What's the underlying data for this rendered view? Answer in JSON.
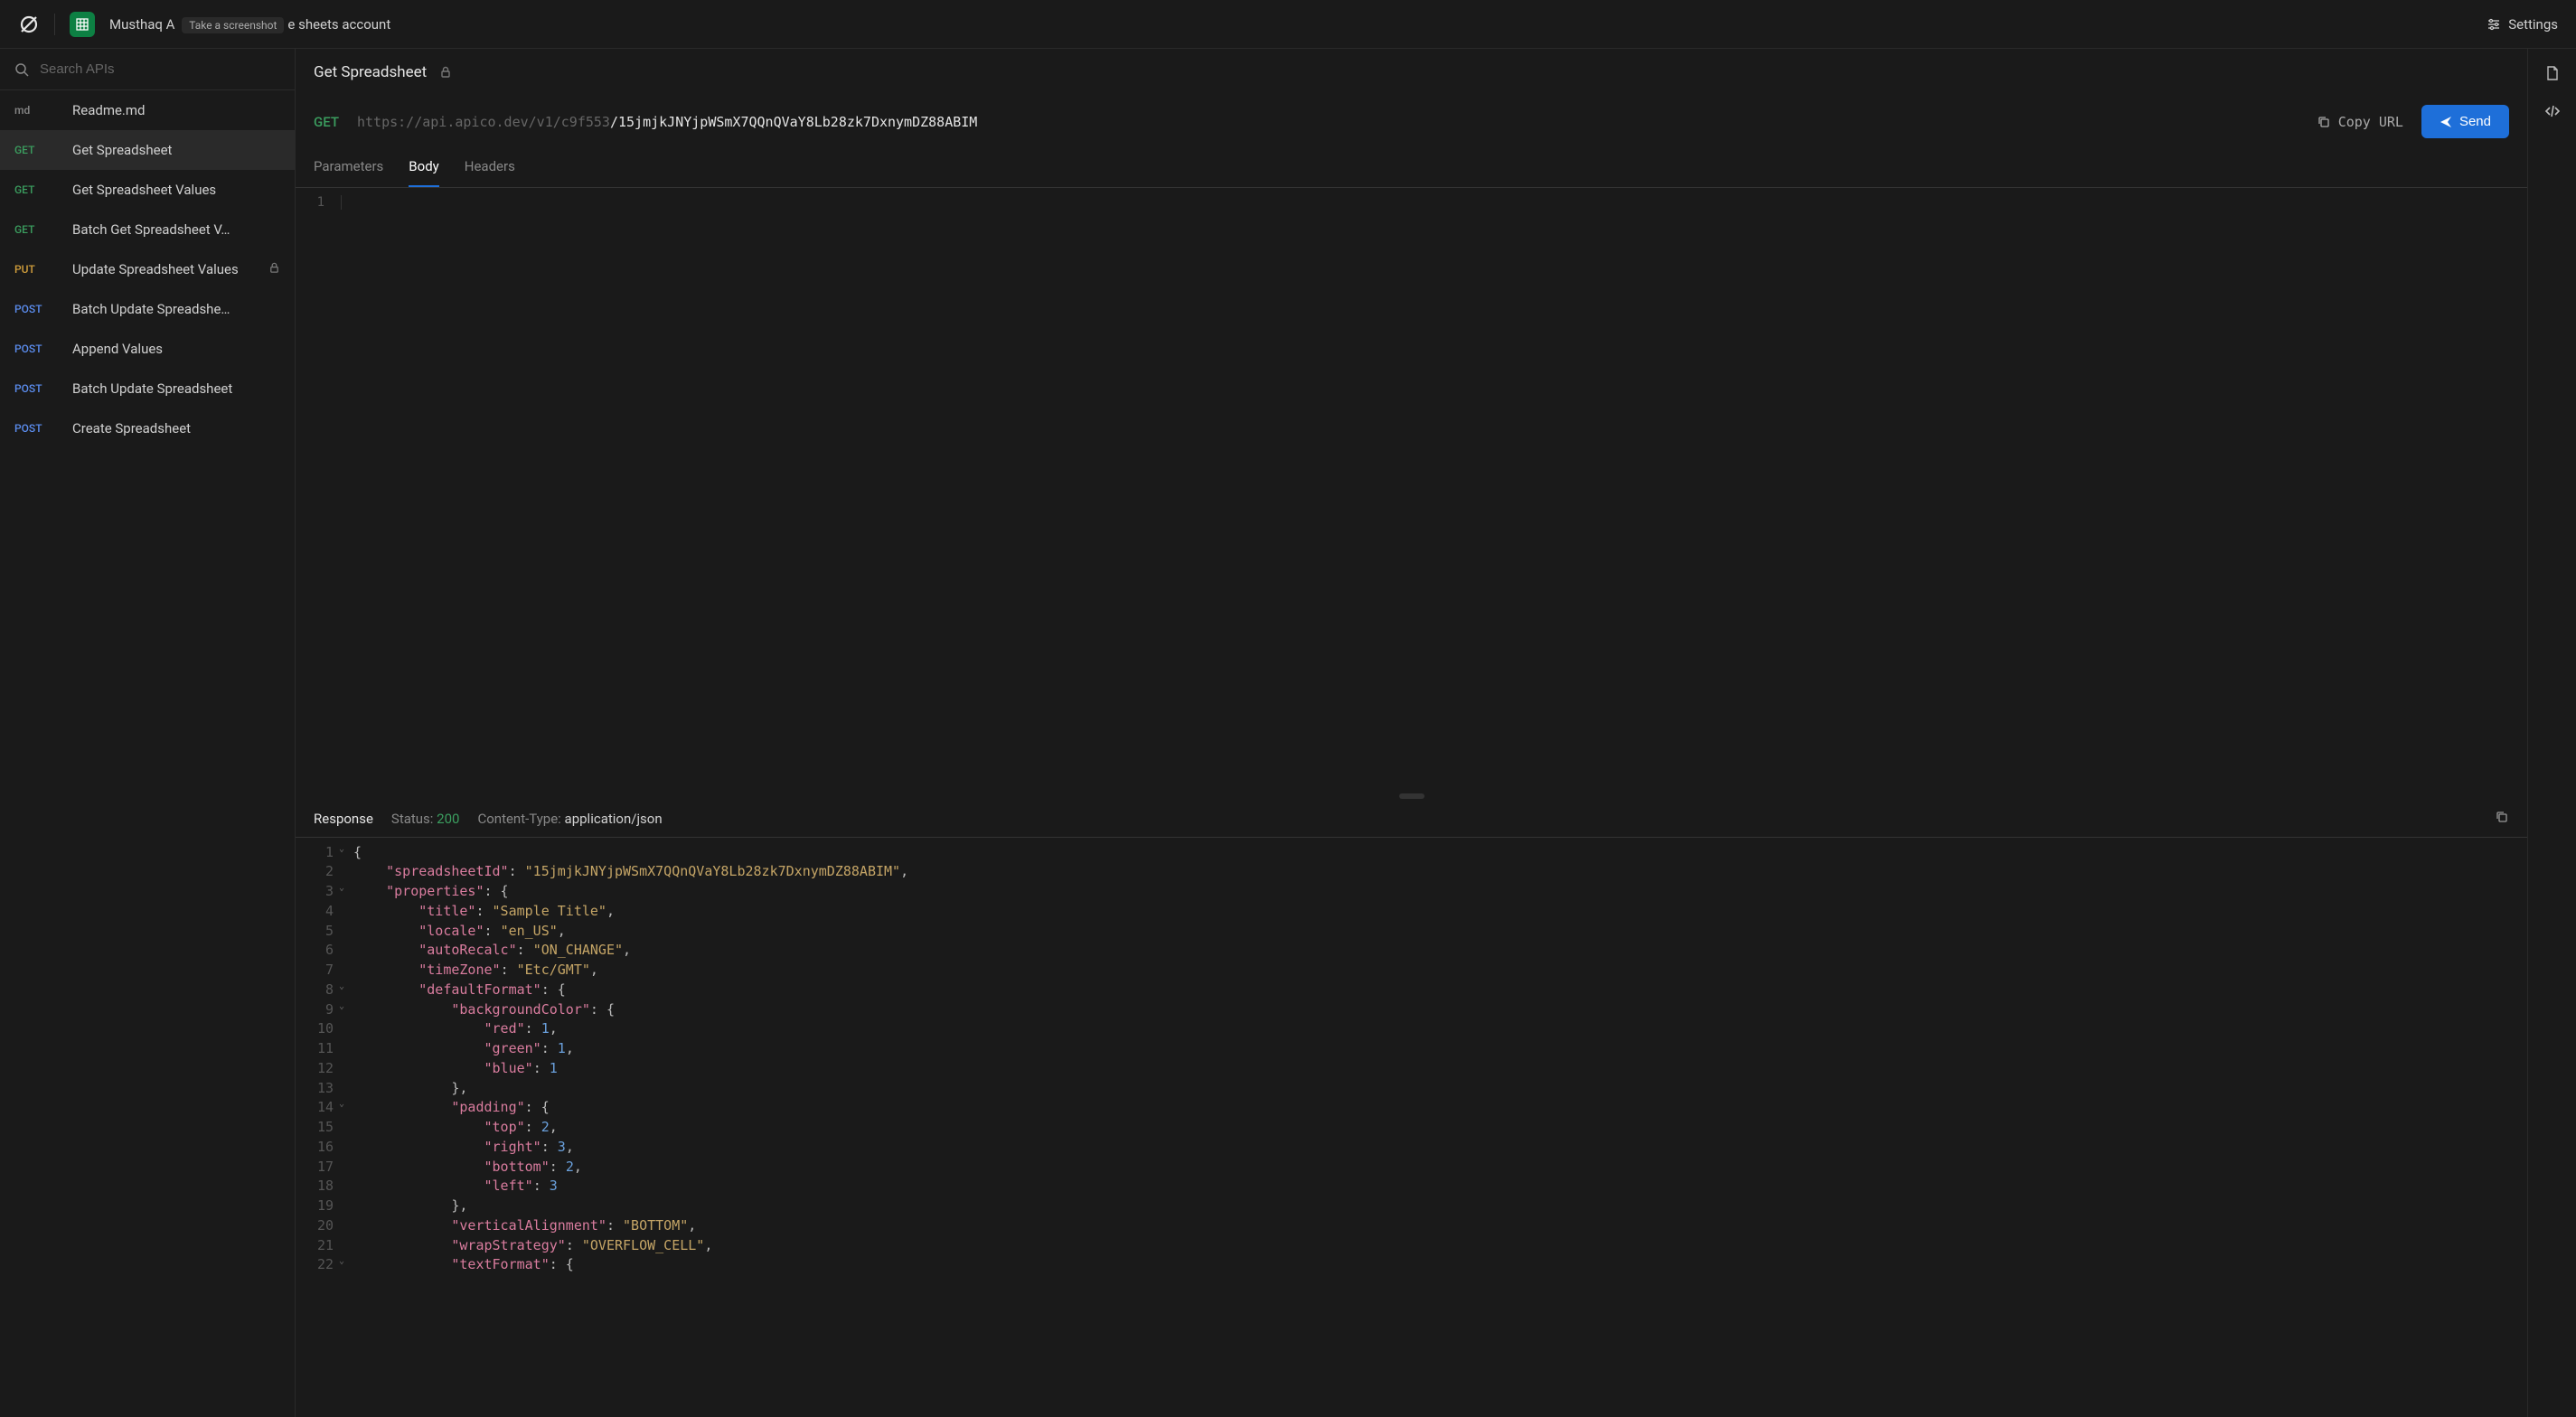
{
  "topbar": {
    "account_prefix": "Musthaq A",
    "screenshot_hint": "Take a screenshot",
    "account_suffix": "e sheets account",
    "settings_label": "Settings"
  },
  "sidebar": {
    "search_placeholder": "Search APIs",
    "items": [
      {
        "method": "md",
        "method_class": "md",
        "name": "Readme.md",
        "active": false,
        "locked": false
      },
      {
        "method": "GET",
        "method_class": "get",
        "name": "Get Spreadsheet",
        "active": true,
        "locked": false
      },
      {
        "method": "GET",
        "method_class": "get",
        "name": "Get Spreadsheet Values",
        "active": false,
        "locked": false
      },
      {
        "method": "GET",
        "method_class": "get",
        "name": "Batch Get Spreadsheet V…",
        "active": false,
        "locked": false
      },
      {
        "method": "PUT",
        "method_class": "put",
        "name": "Update Spreadsheet Values",
        "active": false,
        "locked": true
      },
      {
        "method": "POST",
        "method_class": "post",
        "name": "Batch Update Spreadshe…",
        "active": false,
        "locked": false
      },
      {
        "method": "POST",
        "method_class": "post",
        "name": "Append Values",
        "active": false,
        "locked": false
      },
      {
        "method": "POST",
        "method_class": "post",
        "name": "Batch Update Spreadsheet",
        "active": false,
        "locked": false
      },
      {
        "method": "POST",
        "method_class": "post",
        "name": "Create Spreadsheet",
        "active": false,
        "locked": false
      }
    ]
  },
  "main": {
    "title": "Get Spreadsheet",
    "request": {
      "method": "GET",
      "url_base": "https://api.apico.dev/v1/c9f553",
      "url_path": "/15jmjkJNYjpWSmX7QQnQVaY8Lb28zk7DxnymDZ88ABIM",
      "copy_label": "Copy URL",
      "send_label": "Send"
    },
    "tabs": [
      {
        "label": "Parameters",
        "active": false
      },
      {
        "label": "Body",
        "active": true
      },
      {
        "label": "Headers",
        "active": false
      }
    ],
    "body_lines": [
      "1"
    ],
    "response": {
      "label": "Response",
      "status_label": "Status:",
      "status_code": "200",
      "content_type_label": "Content-Type:",
      "content_type_value": "application/json",
      "lines": [
        {
          "n": 1,
          "fold": true,
          "tokens": [
            [
              "punc",
              "{"
            ]
          ]
        },
        {
          "n": 2,
          "fold": false,
          "tokens": [
            [
              "pad",
              "    "
            ],
            [
              "key",
              "\"spreadsheetId\""
            ],
            [
              "punc",
              ": "
            ],
            [
              "str",
              "\"15jmjkJNYjpWSmX7QQnQVaY8Lb28zk7DxnymDZ88ABIM\""
            ],
            [
              "punc",
              ","
            ]
          ]
        },
        {
          "n": 3,
          "fold": true,
          "tokens": [
            [
              "pad",
              "    "
            ],
            [
              "key",
              "\"properties\""
            ],
            [
              "punc",
              ": {"
            ]
          ]
        },
        {
          "n": 4,
          "fold": false,
          "tokens": [
            [
              "pad",
              "        "
            ],
            [
              "key",
              "\"title\""
            ],
            [
              "punc",
              ": "
            ],
            [
              "str",
              "\"Sample Title\""
            ],
            [
              "punc",
              ","
            ]
          ]
        },
        {
          "n": 5,
          "fold": false,
          "tokens": [
            [
              "pad",
              "        "
            ],
            [
              "key",
              "\"locale\""
            ],
            [
              "punc",
              ": "
            ],
            [
              "str",
              "\"en_US\""
            ],
            [
              "punc",
              ","
            ]
          ]
        },
        {
          "n": 6,
          "fold": false,
          "tokens": [
            [
              "pad",
              "        "
            ],
            [
              "key",
              "\"autoRecalc\""
            ],
            [
              "punc",
              ": "
            ],
            [
              "str",
              "\"ON_CHANGE\""
            ],
            [
              "punc",
              ","
            ]
          ]
        },
        {
          "n": 7,
          "fold": false,
          "tokens": [
            [
              "pad",
              "        "
            ],
            [
              "key",
              "\"timeZone\""
            ],
            [
              "punc",
              ": "
            ],
            [
              "str",
              "\"Etc/GMT\""
            ],
            [
              "punc",
              ","
            ]
          ]
        },
        {
          "n": 8,
          "fold": true,
          "tokens": [
            [
              "pad",
              "        "
            ],
            [
              "key",
              "\"defaultFormat\""
            ],
            [
              "punc",
              ": {"
            ]
          ]
        },
        {
          "n": 9,
          "fold": true,
          "tokens": [
            [
              "pad",
              "            "
            ],
            [
              "key",
              "\"backgroundColor\""
            ],
            [
              "punc",
              ": {"
            ]
          ]
        },
        {
          "n": 10,
          "fold": false,
          "tokens": [
            [
              "pad",
              "                "
            ],
            [
              "key",
              "\"red\""
            ],
            [
              "punc",
              ": "
            ],
            [
              "num",
              "1"
            ],
            [
              "punc",
              ","
            ]
          ]
        },
        {
          "n": 11,
          "fold": false,
          "tokens": [
            [
              "pad",
              "                "
            ],
            [
              "key",
              "\"green\""
            ],
            [
              "punc",
              ": "
            ],
            [
              "num",
              "1"
            ],
            [
              "punc",
              ","
            ]
          ]
        },
        {
          "n": 12,
          "fold": false,
          "tokens": [
            [
              "pad",
              "                "
            ],
            [
              "key",
              "\"blue\""
            ],
            [
              "punc",
              ": "
            ],
            [
              "num",
              "1"
            ]
          ]
        },
        {
          "n": 13,
          "fold": false,
          "tokens": [
            [
              "pad",
              "            "
            ],
            [
              "punc",
              "},"
            ]
          ]
        },
        {
          "n": 14,
          "fold": true,
          "tokens": [
            [
              "pad",
              "            "
            ],
            [
              "key",
              "\"padding\""
            ],
            [
              "punc",
              ": {"
            ]
          ]
        },
        {
          "n": 15,
          "fold": false,
          "tokens": [
            [
              "pad",
              "                "
            ],
            [
              "key",
              "\"top\""
            ],
            [
              "punc",
              ": "
            ],
            [
              "num",
              "2"
            ],
            [
              "punc",
              ","
            ]
          ]
        },
        {
          "n": 16,
          "fold": false,
          "tokens": [
            [
              "pad",
              "                "
            ],
            [
              "key",
              "\"right\""
            ],
            [
              "punc",
              ": "
            ],
            [
              "num",
              "3"
            ],
            [
              "punc",
              ","
            ]
          ]
        },
        {
          "n": 17,
          "fold": false,
          "tokens": [
            [
              "pad",
              "                "
            ],
            [
              "key",
              "\"bottom\""
            ],
            [
              "punc",
              ": "
            ],
            [
              "num",
              "2"
            ],
            [
              "punc",
              ","
            ]
          ]
        },
        {
          "n": 18,
          "fold": false,
          "tokens": [
            [
              "pad",
              "                "
            ],
            [
              "key",
              "\"left\""
            ],
            [
              "punc",
              ": "
            ],
            [
              "num",
              "3"
            ]
          ]
        },
        {
          "n": 19,
          "fold": false,
          "tokens": [
            [
              "pad",
              "            "
            ],
            [
              "punc",
              "},"
            ]
          ]
        },
        {
          "n": 20,
          "fold": false,
          "tokens": [
            [
              "pad",
              "            "
            ],
            [
              "key",
              "\"verticalAlignment\""
            ],
            [
              "punc",
              ": "
            ],
            [
              "str",
              "\"BOTTOM\""
            ],
            [
              "punc",
              ","
            ]
          ]
        },
        {
          "n": 21,
          "fold": false,
          "tokens": [
            [
              "pad",
              "            "
            ],
            [
              "key",
              "\"wrapStrategy\""
            ],
            [
              "punc",
              ": "
            ],
            [
              "str",
              "\"OVERFLOW_CELL\""
            ],
            [
              "punc",
              ","
            ]
          ]
        },
        {
          "n": 22,
          "fold": true,
          "tokens": [
            [
              "pad",
              "            "
            ],
            [
              "key",
              "\"textFormat\""
            ],
            [
              "punc",
              ": {"
            ]
          ]
        }
      ]
    }
  }
}
